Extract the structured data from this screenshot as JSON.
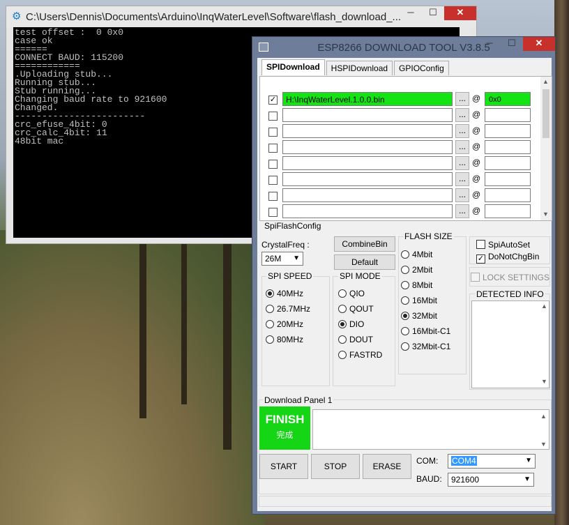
{
  "console": {
    "title": "C:\\Users\\Dennis\\Documents\\Arduino\\InqWaterLevel\\Software\\flash_download_...",
    "lines": [
      "test offset :  0 0x0",
      "case ok",
      "======",
      "CONNECT BAUD: 115200",
      "============",
      ".Uploading stub...",
      "Running stub...",
      "Stub running...",
      "Changing baud rate to 921600",
      "Changed.",
      "------------------------",
      "crc_efuse_4bit: 0",
      "crc_calc_4bit: 11",
      "48bit mac"
    ]
  },
  "window_buttons": {
    "minimize": "─",
    "maximize": "☐",
    "close": "✕"
  },
  "esp": {
    "title": "ESP8266 DOWNLOAD TOOL V3.8.5",
    "tabs": [
      "SPIDownload",
      "HSPIDownload",
      "GPIOConfig"
    ],
    "browse_label": "...",
    "at_label": "@",
    "rows": [
      {
        "checked": true,
        "path": "H:\\InqWaterLevel.1.0.0.bin",
        "addr": "0x0"
      },
      {
        "checked": false,
        "path": "",
        "addr": ""
      },
      {
        "checked": false,
        "path": "",
        "addr": ""
      },
      {
        "checked": false,
        "path": "",
        "addr": ""
      },
      {
        "checked": false,
        "path": "",
        "addr": ""
      },
      {
        "checked": false,
        "path": "",
        "addr": ""
      },
      {
        "checked": false,
        "path": "",
        "addr": ""
      },
      {
        "checked": false,
        "path": "",
        "addr": ""
      }
    ],
    "spi_flash_config_label": "SpiFlashConfig",
    "crystal_label": "CrystalFreq :",
    "crystal_value": "26M",
    "combine_bin": "CombineBin",
    "default_btn": "Default",
    "spi_speed": {
      "label": "SPI SPEED",
      "options": [
        "40MHz",
        "26.7MHz",
        "20MHz",
        "80MHz"
      ],
      "selected": 0
    },
    "spi_mode": {
      "label": "SPI MODE",
      "options": [
        "QIO",
        "QOUT",
        "DIO",
        "DOUT",
        "FASTRD"
      ],
      "selected": 2
    },
    "flash_size": {
      "label": "FLASH SIZE",
      "options": [
        "4Mbit",
        "2Mbit",
        "8Mbit",
        "16Mbit",
        "32Mbit",
        "16Mbit-C1",
        "32Mbit-C1"
      ],
      "selected": 4
    },
    "spi_auto_set": "SpiAutoSet",
    "do_not_chg_bin": "DoNotChgBin",
    "lock_settings": "LOCK SETTINGS",
    "detected_info": "DETECTED INFO",
    "download_panel": "Download Panel 1",
    "finish_en": "FINISH",
    "finish_zh": "完成",
    "start": "START",
    "stop": "STOP",
    "erase": "ERASE",
    "com_label": "COM:",
    "com_value": "COM4",
    "baud_label": "BAUD:",
    "baud_value": "921600",
    "finish_color": "#14d614",
    "highlight_color": "#14e414"
  }
}
